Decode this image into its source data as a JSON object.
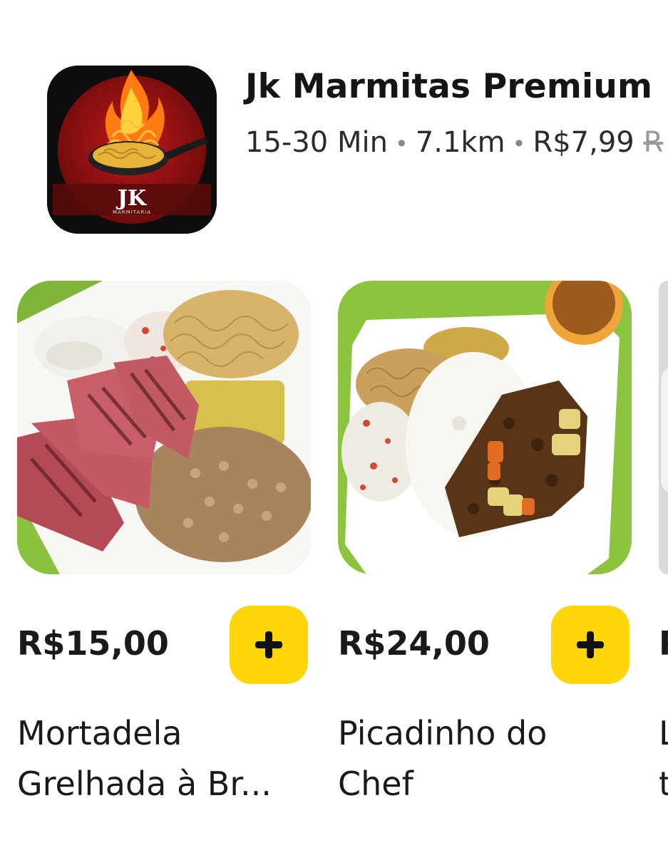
{
  "store": {
    "name": "Jk Marmitas Premium",
    "time": "15-30 Min",
    "distance": "7.1km",
    "fee": "R$7,99",
    "fee_strike": "R",
    "logo_text": "JK",
    "logo_subtext": "MARMITARIA"
  },
  "products": [
    {
      "price": "R$15,00",
      "name_line1": "Mortadela",
      "name_line2": "Grelhada à Br...",
      "image": "food-photo-mortadela"
    },
    {
      "price": "R$24,00",
      "name_line1": "Picadinho do",
      "name_line2": "Chef",
      "image": "food-photo-picadinho"
    },
    {
      "price": "R",
      "name_line1": "L",
      "name_line2": "t"
    }
  ],
  "colors": {
    "accent": "#FFD60A",
    "text": "#1a1a1a",
    "muted": "#9a9a9a"
  },
  "icons": {
    "add": "plus-icon"
  }
}
